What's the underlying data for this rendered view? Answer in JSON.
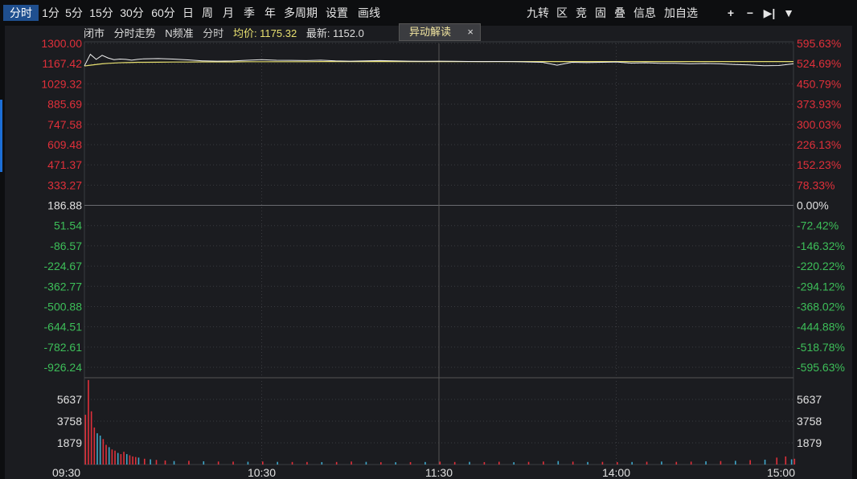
{
  "toolbar": {
    "left_tabs": [
      {
        "label": "分时",
        "active": true
      },
      {
        "label": "1分",
        "active": false
      },
      {
        "label": "5分",
        "active": false
      },
      {
        "label": "15分",
        "active": false
      },
      {
        "label": "30分",
        "active": false
      },
      {
        "label": "60分",
        "active": false
      },
      {
        "label": "日",
        "active": false
      },
      {
        "label": "周",
        "active": false
      },
      {
        "label": "月",
        "active": false
      },
      {
        "label": "季",
        "active": false
      },
      {
        "label": "年",
        "active": false
      },
      {
        "label": "多周期",
        "active": false
      },
      {
        "label": "设置",
        "active": false
      },
      {
        "label": "画线",
        "active": false
      }
    ],
    "right_buttons": [
      "九转",
      "区",
      "竞",
      "固",
      "叠",
      "信息",
      "加自选"
    ],
    "icons": [
      "plus-icon",
      "minus-icon",
      "step-end-icon",
      "chevron-down-icon"
    ],
    "icon_glyphs": [
      "+",
      "−",
      "▶|",
      "▼"
    ]
  },
  "info_bar": {
    "status": "闭市",
    "mode": "分时走势",
    "freq": "N频准",
    "series_label": "分时",
    "avg_label": "均价: 1175.32",
    "latest_label": "最新: 1152.0"
  },
  "popup": {
    "label": "异动解读",
    "close": "×"
  },
  "colors": {
    "up": "#e0303a",
    "down": "#3dbf59",
    "neutral": "#e0e0e0",
    "price_line": "#f0f0f0",
    "avg_line": "#e8e070",
    "grid": "#3a3b40",
    "series_label": "#cccccc",
    "avg_label": "#e8e070",
    "accent": "#1f4f8f"
  },
  "chart_data": {
    "type": "line",
    "title": "",
    "price_ticks_up": [
      "1300.00",
      "1167.42",
      "1029.32",
      "885.69",
      "747.58",
      "609.48",
      "471.37",
      "333.27"
    ],
    "price_tick_mid": "186.88",
    "price_ticks_down": [
      "51.54",
      "-86.57",
      "-224.67",
      "-362.77",
      "-500.88",
      "-644.51",
      "-782.61",
      "-926.24"
    ],
    "pct_ticks_up": [
      "595.63%",
      "524.69%",
      "450.79%",
      "373.93%",
      "300.03%",
      "226.13%",
      "152.23%",
      "78.33%"
    ],
    "pct_tick_mid": "0.00%",
    "pct_ticks_down": [
      "-72.42%",
      "-146.32%",
      "-220.22%",
      "-294.12%",
      "-368.02%",
      "-444.88%",
      "-518.78%",
      "-595.63%"
    ],
    "volume_ticks": [
      "5637",
      "3758",
      "1879"
    ],
    "time_labels": [
      "09:30",
      "10:30",
      "11:30",
      "14:00",
      "15:00"
    ],
    "price_range": [
      -926.24,
      1300.0
    ],
    "volume_max": 7500,
    "minutes": [
      0,
      2,
      4,
      6,
      8,
      10,
      12,
      14,
      16,
      18,
      20,
      25,
      30,
      35,
      40,
      45,
      50,
      55,
      60,
      65,
      70,
      75,
      80,
      85,
      90,
      95,
      100,
      105,
      110,
      115,
      120,
      125,
      130,
      135,
      140,
      145,
      150,
      155,
      160,
      165,
      170,
      175,
      180,
      185,
      190,
      195,
      200,
      205,
      210,
      215,
      220,
      225,
      230,
      235,
      240
    ],
    "price": [
      1145,
      1225,
      1190,
      1218,
      1200,
      1188,
      1192,
      1190,
      1185,
      1190,
      1194,
      1196,
      1192,
      1187,
      1180,
      1178,
      1179,
      1184,
      1188,
      1184,
      1183,
      1182,
      1185,
      1180,
      1178,
      1180,
      1182,
      1180,
      1178,
      1177,
      1178,
      1177,
      1176,
      1175,
      1176,
      1175,
      1172,
      1170,
      1150,
      1170,
      1168,
      1170,
      1172,
      1165,
      1167,
      1163,
      1163,
      1160,
      1162,
      1160,
      1155,
      1152,
      1147,
      1148,
      1160
    ],
    "avg": [
      1145,
      1150,
      1155,
      1160,
      1163,
      1165,
      1167,
      1168,
      1169,
      1170,
      1170,
      1171,
      1172,
      1172,
      1173,
      1173,
      1173,
      1174,
      1174,
      1174,
      1174,
      1174,
      1175,
      1175,
      1175,
      1175,
      1175,
      1175,
      1175,
      1175,
      1175,
      1175,
      1175,
      1175,
      1175,
      1175,
      1175,
      1175,
      1175,
      1175,
      1175,
      1175,
      1175,
      1175,
      1175,
      1175,
      1175,
      1175,
      1175,
      1175,
      1175,
      1175,
      1175,
      1175,
      1175
    ],
    "volume": [
      {
        "m": 0,
        "v": 4300,
        "d": "up"
      },
      {
        "m": 1,
        "v": 7300,
        "d": "up"
      },
      {
        "m": 2,
        "v": 4600,
        "d": "up"
      },
      {
        "m": 3,
        "v": 3200,
        "d": "up"
      },
      {
        "m": 4,
        "v": 2700,
        "d": "down"
      },
      {
        "m": 5,
        "v": 2500,
        "d": "down"
      },
      {
        "m": 6,
        "v": 2200,
        "d": "up"
      },
      {
        "m": 7,
        "v": 1700,
        "d": "up"
      },
      {
        "m": 8,
        "v": 1500,
        "d": "down"
      },
      {
        "m": 9,
        "v": 1300,
        "d": "up"
      },
      {
        "m": 10,
        "v": 1200,
        "d": "up"
      },
      {
        "m": 11,
        "v": 1000,
        "d": "down"
      },
      {
        "m": 12,
        "v": 900,
        "d": "up"
      },
      {
        "m": 13,
        "v": 1100,
        "d": "up"
      },
      {
        "m": 14,
        "v": 900,
        "d": "down"
      },
      {
        "m": 15,
        "v": 800,
        "d": "up"
      },
      {
        "m": 16,
        "v": 700,
        "d": "up"
      },
      {
        "m": 17,
        "v": 650,
        "d": "up"
      },
      {
        "m": 18,
        "v": 600,
        "d": "down"
      },
      {
        "m": 20,
        "v": 500,
        "d": "up"
      },
      {
        "m": 22,
        "v": 450,
        "d": "down"
      },
      {
        "m": 24,
        "v": 400,
        "d": "up"
      },
      {
        "m": 27,
        "v": 350,
        "d": "up"
      },
      {
        "m": 30,
        "v": 300,
        "d": "down"
      },
      {
        "m": 35,
        "v": 320,
        "d": "up"
      },
      {
        "m": 40,
        "v": 280,
        "d": "down"
      },
      {
        "m": 45,
        "v": 260,
        "d": "up"
      },
      {
        "m": 50,
        "v": 250,
        "d": "up"
      },
      {
        "m": 55,
        "v": 240,
        "d": "down"
      },
      {
        "m": 60,
        "v": 260,
        "d": "up"
      },
      {
        "m": 65,
        "v": 230,
        "d": "down"
      },
      {
        "m": 70,
        "v": 220,
        "d": "up"
      },
      {
        "m": 75,
        "v": 220,
        "d": "up"
      },
      {
        "m": 80,
        "v": 210,
        "d": "down"
      },
      {
        "m": 85,
        "v": 220,
        "d": "up"
      },
      {
        "m": 90,
        "v": 260,
        "d": "up"
      },
      {
        "m": 95,
        "v": 230,
        "d": "down"
      },
      {
        "m": 100,
        "v": 200,
        "d": "up"
      },
      {
        "m": 105,
        "v": 200,
        "d": "down"
      },
      {
        "m": 110,
        "v": 210,
        "d": "up"
      },
      {
        "m": 115,
        "v": 220,
        "d": "down"
      },
      {
        "m": 120,
        "v": 250,
        "d": "up"
      },
      {
        "m": 125,
        "v": 220,
        "d": "up"
      },
      {
        "m": 130,
        "v": 230,
        "d": "down"
      },
      {
        "m": 135,
        "v": 210,
        "d": "up"
      },
      {
        "m": 140,
        "v": 240,
        "d": "up"
      },
      {
        "m": 145,
        "v": 200,
        "d": "down"
      },
      {
        "m": 150,
        "v": 230,
        "d": "up"
      },
      {
        "m": 155,
        "v": 260,
        "d": "up"
      },
      {
        "m": 160,
        "v": 300,
        "d": "down"
      },
      {
        "m": 165,
        "v": 250,
        "d": "up"
      },
      {
        "m": 170,
        "v": 220,
        "d": "down"
      },
      {
        "m": 175,
        "v": 230,
        "d": "up"
      },
      {
        "m": 180,
        "v": 210,
        "d": "up"
      },
      {
        "m": 185,
        "v": 220,
        "d": "down"
      },
      {
        "m": 190,
        "v": 240,
        "d": "up"
      },
      {
        "m": 195,
        "v": 260,
        "d": "down"
      },
      {
        "m": 200,
        "v": 230,
        "d": "up"
      },
      {
        "m": 205,
        "v": 250,
        "d": "up"
      },
      {
        "m": 210,
        "v": 280,
        "d": "down"
      },
      {
        "m": 215,
        "v": 300,
        "d": "up"
      },
      {
        "m": 220,
        "v": 320,
        "d": "down"
      },
      {
        "m": 225,
        "v": 380,
        "d": "up"
      },
      {
        "m": 230,
        "v": 420,
        "d": "down"
      },
      {
        "m": 234,
        "v": 600,
        "d": "up"
      },
      {
        "m": 237,
        "v": 700,
        "d": "up"
      },
      {
        "m": 239,
        "v": 450,
        "d": "down"
      },
      {
        "m": 240,
        "v": 500,
        "d": "up"
      }
    ]
  }
}
